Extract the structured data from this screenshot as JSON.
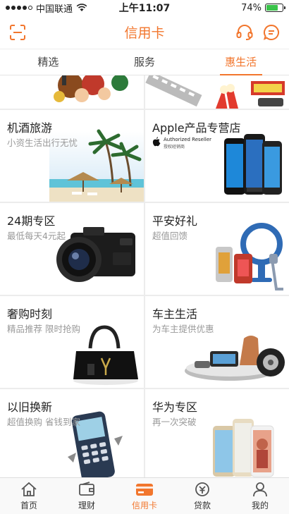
{
  "status_bar": {
    "carrier": "中国联通",
    "time": "上午11:07",
    "battery": "74%",
    "battery_level": 0.74
  },
  "nav": {
    "title": "信用卡",
    "scan_icon": "scan-icon",
    "service_icon": "headset-icon",
    "message_icon": "message-icon"
  },
  "tabs": [
    {
      "label": "精选",
      "active": false
    },
    {
      "label": "服务",
      "active": false
    },
    {
      "label": "惠生活",
      "active": true
    }
  ],
  "cards": [
    {
      "title": "机酒旅游",
      "subtitle": "小资生活出行无忧"
    },
    {
      "title": "Apple产品专营店",
      "subtitle": "",
      "badge_line1": "Authorized Reseller",
      "badge_line2": "授权经销商"
    },
    {
      "title": "24期专区",
      "subtitle": "最低每天4元起"
    },
    {
      "title": "平安好礼",
      "subtitle": "超值回馈"
    },
    {
      "title": "奢购时刻",
      "subtitle": "精品推荐 限时抢购"
    },
    {
      "title": "车主生活",
      "subtitle": "为车主提供优惠"
    },
    {
      "title": "以旧换新",
      "subtitle": "超值换购 省钱到家"
    },
    {
      "title": "华为专区",
      "subtitle": "再一次突破"
    }
  ],
  "bottom_tabs": [
    {
      "label": "首页",
      "icon": "home-icon",
      "active": false
    },
    {
      "label": "理财",
      "icon": "wallet-icon",
      "active": false
    },
    {
      "label": "信用卡",
      "icon": "credit-card-icon",
      "active": true
    },
    {
      "label": "贷款",
      "icon": "loan-icon",
      "active": false
    },
    {
      "label": "我的",
      "icon": "profile-icon",
      "active": false
    }
  ],
  "colors": {
    "accent": "#f2762d",
    "text": "#222222",
    "subtext": "#999999",
    "background": "#ececec"
  }
}
